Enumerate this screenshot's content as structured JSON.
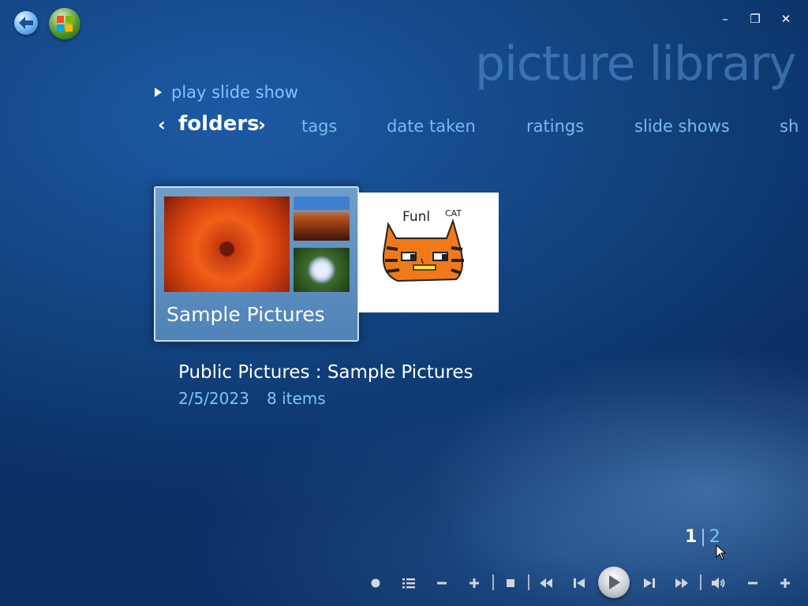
{
  "header": {
    "page_title": "picture library",
    "play_slide_show": "play slide show"
  },
  "nav_tabs": {
    "active": "folders",
    "left_chevron": "‹",
    "right_chevron": "›",
    "items": [
      "tags",
      "date taken",
      "ratings",
      "slide shows",
      "sh"
    ]
  },
  "window_controls": {
    "minimize": "–",
    "restore": "❐",
    "close": "✕"
  },
  "tiles": {
    "folder": {
      "label": "Sample Pictures"
    },
    "cat_image_text": {
      "fun": "Funl",
      "cat": "CAT"
    }
  },
  "details": {
    "path": "Public Pictures : Sample Pictures",
    "date": "2/5/2023",
    "count": "8 items"
  },
  "pager": {
    "current": "1",
    "separator": "|",
    "other": "2"
  },
  "colors": {
    "accent_text": "#7fc4ff",
    "background_dark": "#0b2e63",
    "background_mid": "#12437f",
    "tile_blue": "#5b8fc0",
    "cat_orange": "#f07a1a"
  },
  "transport_icons": [
    "record-icon",
    "guide-list-icon",
    "channel-minus-icon",
    "channel-plus-icon",
    "stop-icon",
    "rewind-icon",
    "skip-back-icon",
    "play-icon",
    "skip-forward-icon",
    "fast-forward-icon",
    "mute-icon",
    "volume-minus-icon",
    "volume-plus-icon"
  ]
}
